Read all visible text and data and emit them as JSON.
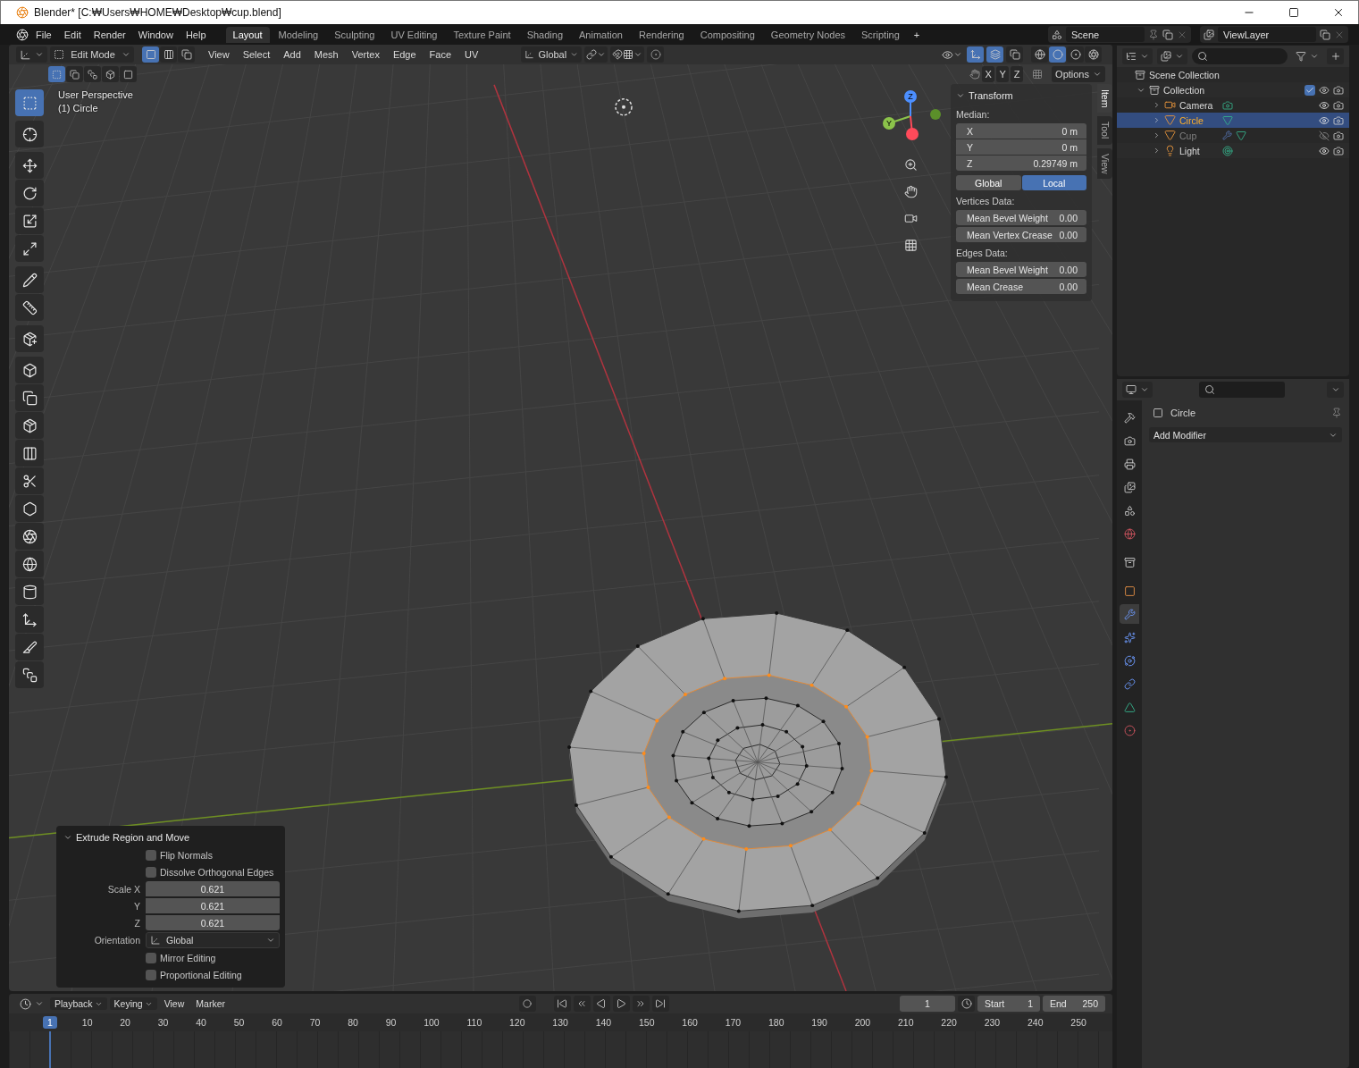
{
  "window": {
    "title": "Blender* [C:₩Users₩HOME₩Desktop₩cup.blend]"
  },
  "menu": [
    "File",
    "Edit",
    "Render",
    "Window",
    "Help"
  ],
  "workspaces": [
    {
      "label": "Layout",
      "selected": true
    },
    {
      "label": "Modeling",
      "selected": false
    },
    {
      "label": "Sculpting",
      "selected": false
    },
    {
      "label": "UV Editing",
      "selected": false
    },
    {
      "label": "Texture Paint",
      "selected": false
    },
    {
      "label": "Shading",
      "selected": false
    },
    {
      "label": "Animation",
      "selected": false
    },
    {
      "label": "Rendering",
      "selected": false
    },
    {
      "label": "Compositing",
      "selected": false
    },
    {
      "label": "Geometry Nodes",
      "selected": false
    },
    {
      "label": "Scripting",
      "selected": false
    }
  ],
  "add_workspace": "+",
  "scene": "Scene",
  "view_layer": "ViewLayer",
  "viewport": {
    "mode": "Edit Mode",
    "select_modes": [
      {
        "selected": true
      },
      {
        "selected": false
      },
      {
        "selected": false
      }
    ],
    "menus": [
      "View",
      "Select",
      "Add",
      "Mesh",
      "Vertex",
      "Edge",
      "Face",
      "UV"
    ],
    "orientation": "Global",
    "gizmos_on": true,
    "overlays_on": true,
    "xray_on": false,
    "shading": [
      {
        "selected": false
      },
      {
        "selected": true
      },
      {
        "selected": false
      },
      {
        "selected": false
      }
    ],
    "box_modes": [
      {
        "selected": true
      },
      {
        "selected": false
      },
      {
        "selected": false
      },
      {
        "selected": false
      },
      {
        "selected": false
      }
    ],
    "mirror_axes": [
      {
        "label": "X",
        "selected": false
      },
      {
        "label": "Y",
        "selected": false
      },
      {
        "label": "Z",
        "selected": false
      }
    ],
    "options": "Options",
    "view_name": "User Perspective",
    "object_name": "(1) Circle",
    "tools": [
      {
        "selected": true
      },
      {
        "selected": false
      },
      {
        "selected": false
      },
      {
        "selected": false
      },
      {
        "selected": false
      },
      {
        "selected": false
      },
      {
        "selected": false
      },
      {
        "selected": false
      },
      {
        "selected": false
      },
      {
        "selected": false
      },
      {
        "selected": false
      },
      {
        "selected": false
      },
      {
        "selected": false
      },
      {
        "selected": false
      },
      {
        "selected": false
      },
      {
        "selected": false
      },
      {
        "selected": false
      },
      {
        "selected": false
      },
      {
        "selected": false
      },
      {
        "selected": false
      },
      {
        "selected": false
      }
    ],
    "gizmo_axes": [
      "Y",
      "Z"
    ],
    "sidebar_tabs": [
      {
        "label": "Item",
        "selected": true
      },
      {
        "label": "Tool",
        "selected": false
      },
      {
        "label": "View",
        "selected": false
      }
    ],
    "transform": {
      "title": "Transform",
      "median_label": "Median:",
      "fields": [
        {
          "label": "X",
          "value": "0 m"
        },
        {
          "label": "Y",
          "value": "0 m"
        },
        {
          "label": "Z",
          "value": "0.29749 m"
        }
      ],
      "space": [
        {
          "label": "Global",
          "selected": false
        },
        {
          "label": "Local",
          "selected": true
        }
      ],
      "vertices_label": "Vertices Data:",
      "vertices": [
        {
          "label": "Mean Bevel Weight",
          "value": "0.00"
        },
        {
          "label": "Mean Vertex Crease",
          "value": "0.00"
        }
      ],
      "edges_label": "Edges Data:",
      "edges": [
        {
          "label": "Mean Bevel Weight",
          "value": "0.00"
        },
        {
          "label": "Mean Crease",
          "value": "0.00"
        }
      ]
    }
  },
  "redo_panel": {
    "title": "Extrude Region and Move",
    "expanded": true,
    "rows": [
      {
        "kind": "checkbox",
        "label": "Flip Normals",
        "checked": false
      },
      {
        "kind": "checkbox",
        "label": "Dissolve Orthogonal Edges",
        "checked": false
      },
      {
        "kind": "number",
        "label": "Scale X",
        "value": "0.621"
      },
      {
        "kind": "number",
        "label": "Y",
        "value": "0.621"
      },
      {
        "kind": "number",
        "label": "Z",
        "value": "0.621"
      },
      {
        "kind": "dropdown",
        "label": "Orientation",
        "value": "Global"
      },
      {
        "kind": "checkbox",
        "label": "Mirror Editing",
        "checked": false
      },
      {
        "kind": "checkbox",
        "label": "Proportional Editing",
        "checked": false
      }
    ]
  },
  "outliner": {
    "root": "Scene Collection",
    "collection": {
      "label": "Collection",
      "checked": true,
      "expanded": true,
      "children": [
        {
          "label": "Camera",
          "kind": "camera",
          "selected": false,
          "visible": true,
          "has_modifier": false,
          "expanded": false
        },
        {
          "label": "Circle",
          "kind": "mesh",
          "selected": true,
          "visible": true,
          "has_modifier": false,
          "expanded": false
        },
        {
          "label": "Cup",
          "kind": "mesh",
          "selected": false,
          "visible": false,
          "has_modifier": true,
          "expanded": false
        },
        {
          "label": "Light",
          "kind": "light",
          "selected": false,
          "visible": true,
          "has_modifier": false,
          "expanded": false
        }
      ]
    }
  },
  "properties": {
    "object": "Circle",
    "add_modifier": "Add Modifier",
    "tabs": [
      {
        "kind": "tool",
        "selected": false
      },
      {
        "kind": "render",
        "selected": false
      },
      {
        "kind": "output",
        "selected": false
      },
      {
        "kind": "view_layer",
        "selected": false
      },
      {
        "kind": "scene",
        "selected": false
      },
      {
        "kind": "world",
        "selected": false
      },
      {
        "kind": "collection",
        "selected": false
      },
      {
        "kind": "object",
        "selected": false
      },
      {
        "kind": "modifiers",
        "selected": true
      },
      {
        "kind": "particles",
        "selected": false
      },
      {
        "kind": "physics",
        "selected": false
      },
      {
        "kind": "constraints",
        "selected": false
      },
      {
        "kind": "data",
        "selected": false
      },
      {
        "kind": "material",
        "selected": false
      }
    ]
  },
  "timeline": {
    "menus": [
      "Playback",
      "Keying",
      "View",
      "Marker"
    ],
    "current_frame": "1",
    "start_label": "Start",
    "start": "1",
    "end_label": "End",
    "end": "250",
    "ticks": [
      {
        "label": "1",
        "selected": true
      },
      {
        "label": "10",
        "selected": false
      },
      {
        "label": "20",
        "selected": false
      },
      {
        "label": "30",
        "selected": false
      },
      {
        "label": "40",
        "selected": false
      },
      {
        "label": "50",
        "selected": false
      },
      {
        "label": "60",
        "selected": false
      },
      {
        "label": "70",
        "selected": false
      },
      {
        "label": "80",
        "selected": false
      },
      {
        "label": "90",
        "selected": false
      },
      {
        "label": "100",
        "selected": false
      },
      {
        "label": "110",
        "selected": false
      },
      {
        "label": "120",
        "selected": false
      },
      {
        "label": "130",
        "selected": false
      },
      {
        "label": "140",
        "selected": false
      },
      {
        "label": "150",
        "selected": false
      },
      {
        "label": "160",
        "selected": false
      },
      {
        "label": "170",
        "selected": false
      },
      {
        "label": "180",
        "selected": false
      },
      {
        "label": "190",
        "selected": false
      },
      {
        "label": "200",
        "selected": false
      },
      {
        "label": "210",
        "selected": false
      },
      {
        "label": "220",
        "selected": false
      },
      {
        "label": "230",
        "selected": false
      },
      {
        "label": "240",
        "selected": false
      },
      {
        "label": "250",
        "selected": false
      }
    ]
  }
}
